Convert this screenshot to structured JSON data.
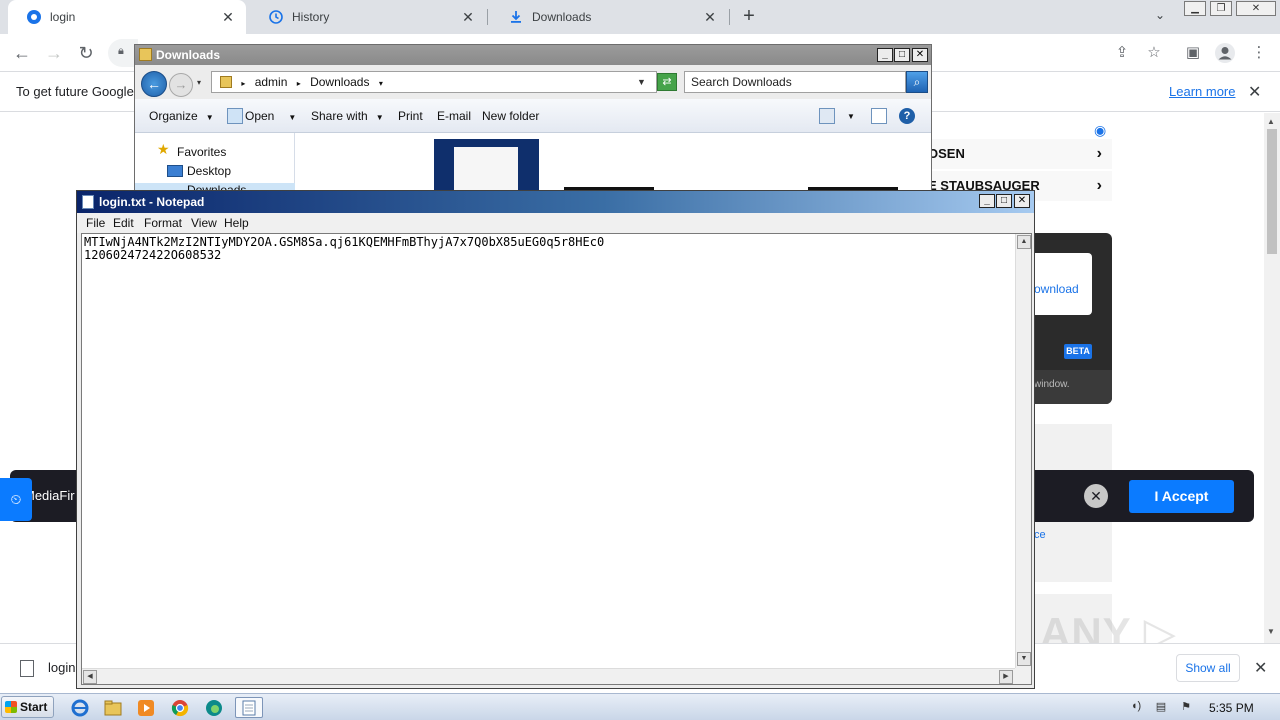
{
  "browser": {
    "tabs": [
      {
        "label": "login",
        "active": true
      },
      {
        "label": "History",
        "active": false
      },
      {
        "label": "Downloads",
        "active": false
      }
    ],
    "infobar": {
      "message": "To get future Google",
      "learn_more": "Learn more"
    }
  },
  "page": {
    "ad_items": [
      "OSEN",
      "E STAUBSAUGER"
    ],
    "panel": {
      "link": "ownload",
      "beta": "BETA",
      "window_text": "window."
    },
    "side_link": "ce",
    "cookie": {
      "brand": "MediaFir",
      "accept": "I Accept"
    },
    "watermark": "ANY ▷ RUN"
  },
  "download_shelf": {
    "file": "login.",
    "show_all": "Show all"
  },
  "explorer": {
    "title": "Downloads",
    "breadcrumb": [
      "admin",
      "Downloads"
    ],
    "search_placeholder": "Search Downloads",
    "commands": {
      "organize": "Organize",
      "open": "Open",
      "share_with": "Share with",
      "print": "Print",
      "email": "E-mail",
      "new_folder": "New folder"
    },
    "nav": {
      "favorites": "Favorites",
      "desktop": "Desktop",
      "downloads": "Downloads"
    }
  },
  "notepad": {
    "title": "login.txt - Notepad",
    "menu": [
      "File",
      "Edit",
      "Format",
      "View",
      "Help"
    ],
    "lines": [
      "MTIwNjA4NTk2MzI2NTIyMDY2OA.GSM8Sa.qj61KQEMHFmBThyjA7x7Q0bX85uEG0q5r8HEc0",
      "120602472422O608532"
    ]
  },
  "taskbar": {
    "start": "Start",
    "clock": "5:35 PM"
  },
  "colors": {
    "accent_blue": "#0b7bff",
    "link_blue": "#1a73e8",
    "cookie_bg": "#1c1c24",
    "notepad_title_start": "#0a246a"
  }
}
